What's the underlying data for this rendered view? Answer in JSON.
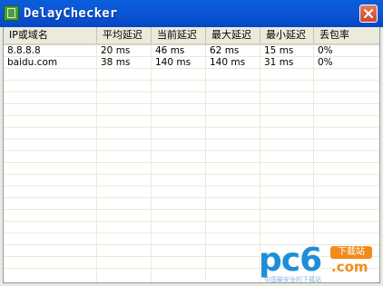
{
  "window": {
    "title": "DelayChecker"
  },
  "columns": [
    "IP或域名",
    "平均延迟",
    "当前延迟",
    "最大延迟",
    "最小延迟",
    "丢包率"
  ],
  "rows": [
    [
      "8.8.8.8",
      "20 ms",
      "46 ms",
      "62 ms",
      "15 ms",
      "0%"
    ],
    [
      "baidu.com",
      "38 ms",
      "140 ms",
      "140 ms",
      "31 ms",
      "0%"
    ]
  ],
  "watermark": {
    "logo": "pc6",
    "badge": "下载站",
    "domain": ".com",
    "tagline": "中国最安全的下载站"
  },
  "colors": {
    "titlebar": "#0b56d6",
    "close": "#c9462d",
    "watermark_blue": "#1d8fd8",
    "watermark_orange": "#f28b1c"
  },
  "icons": {
    "app": "app-icon",
    "close": "close-icon"
  }
}
